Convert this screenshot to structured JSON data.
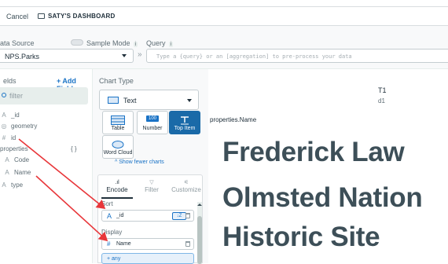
{
  "topbar": {
    "cancel_label": "Cancel",
    "dashboard_title": "SATY'S DASHBOARD"
  },
  "source": {
    "data_source_label": "ata Source",
    "data_source_value": "NPS.Parks",
    "sample_mode_label": "Sample Mode",
    "info_badge": "i",
    "query_label": "Query",
    "query_placeholder": "Type a {query} or an [aggregation] to pre-process your data"
  },
  "fields": {
    "title": "elds",
    "add_field_label": "+ Add Field",
    "filter_placeholder": "filter",
    "items": [
      {
        "icon": "A",
        "name": "_id"
      },
      {
        "icon": "◎",
        "name": "geometry"
      },
      {
        "icon": "#",
        "name": "id"
      },
      {
        "icon": "",
        "name": "properties",
        "brace": "{ }"
      },
      {
        "icon": "A",
        "name": "Code"
      },
      {
        "icon": "A",
        "name": "Name"
      },
      {
        "icon": "A",
        "name": "type"
      }
    ]
  },
  "chart_config": {
    "chart_type_label": "Chart Type",
    "selected_type": "Text",
    "types": [
      {
        "name": "Table",
        "active": false
      },
      {
        "name": "Number",
        "active": false,
        "icon_text": "100"
      },
      {
        "name": "Top Item",
        "active": true
      },
      {
        "name": "Word Cloud",
        "active": false
      }
    ],
    "show_fewer_label": "^ Show fewer charts",
    "tabs": [
      {
        "name": "Encode",
        "active": true
      },
      {
        "name": "Filter",
        "active": false
      },
      {
        "name": "Customize",
        "active": false
      }
    ],
    "sort_label": "Sort",
    "sort_field_type": "A",
    "sort_field": "_id",
    "sort_toggle": "↓Z",
    "display_label": "Display",
    "display_field_type": "#",
    "display_field": "Name",
    "any_label": "+ any"
  },
  "preview": {
    "t1": "T1",
    "d1": "d1",
    "property_label": "properties.Name",
    "lines": [
      "Frederick Law",
      "Olmsted Nation",
      "Historic Site"
    ]
  },
  "colors": {
    "accent": "#1a73c6",
    "active_chart": "#1a6aa8",
    "annotation_arrow": "#e8363a"
  }
}
